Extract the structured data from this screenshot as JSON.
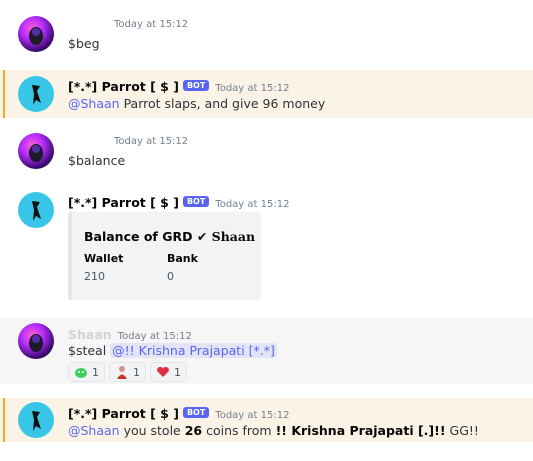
{
  "messages": {
    "m1": {
      "timestamp": "Today at 15:12",
      "text": "$beg"
    },
    "m2": {
      "username": "[*.*] Parrot [ $ ]",
      "bot_badge": "BOT",
      "timestamp": "Today at 15:12",
      "mention": "@Shaan",
      "text": " Parrot slaps, and give 96 money"
    },
    "m3": {
      "timestamp": "Today at 15:12",
      "text": "$balance"
    },
    "m4": {
      "username": "[*.*] Parrot [ $ ]",
      "bot_badge": "BOT",
      "timestamp": "Today at 15:12",
      "embed": {
        "title_prefix": "Balance of GRD",
        "check": "✔",
        "title_name": "Shaan",
        "fields": [
          {
            "name": "Wallet",
            "value": "210"
          },
          {
            "name": "Bank",
            "value": "0"
          }
        ]
      }
    },
    "m5": {
      "username": "Shaan",
      "timestamp": "Today at 15:12",
      "text": "$steal ",
      "mention": "@!! Krishna Prajapati [*.*]",
      "reactions": [
        {
          "emoji": "green-blob",
          "count": "1"
        },
        {
          "emoji": "red-figure",
          "count": "1"
        },
        {
          "emoji": "heart",
          "count": "1"
        }
      ]
    },
    "m6": {
      "username": "[*.*] Parrot [ $ ]",
      "bot_badge": "BOT",
      "timestamp": "Today at 15:12",
      "mention": "@Shaan",
      "t1": " you stole ",
      "coins": "26",
      "t2": " coins from ",
      "victim": "!! Krishna Prajapati [.]!!",
      "t3": " GG!!"
    }
  },
  "colors": {
    "accent": "#5865f2",
    "highlight_bg": "#fbf4e6",
    "highlight_bar": "#f0a732",
    "bot_avatar": "#37c6e8"
  }
}
